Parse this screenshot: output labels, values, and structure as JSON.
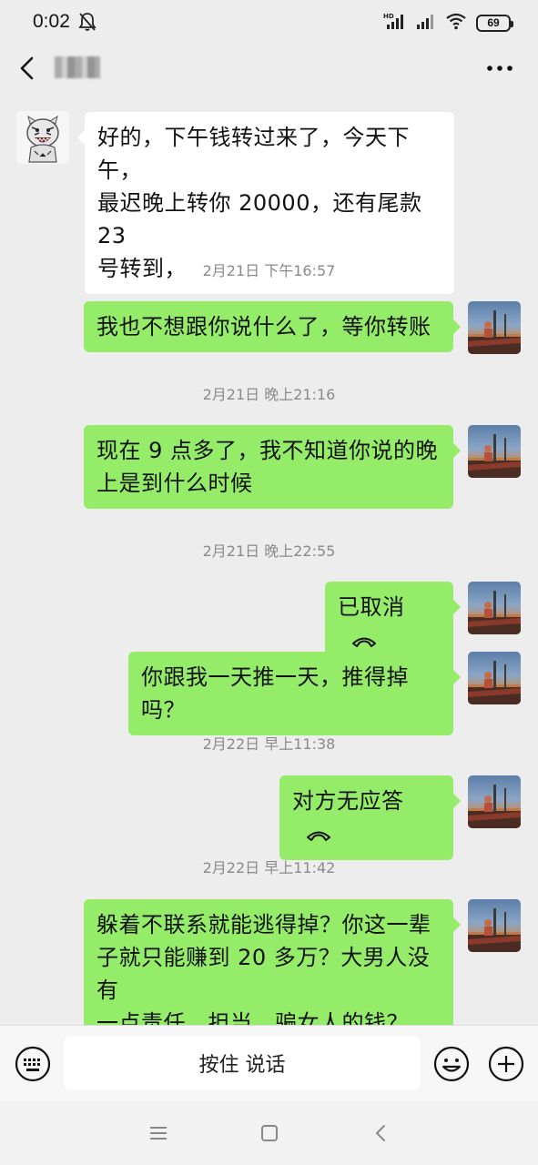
{
  "status_bar": {
    "time": "0:02",
    "battery": "69",
    "icons": [
      "bell-off-icon",
      "hd-signal-icon",
      "signal-icon",
      "wifi-icon",
      "battery-icon"
    ]
  },
  "header": {
    "title": "■■",
    "icons": [
      "back-icon",
      "more-icon"
    ]
  },
  "messages": [
    {
      "side": "left",
      "lines": [
        "好的，下午钱转过来了，今天下午，",
        "最迟晚上转你 20000，还有尾款 23",
        "号转到，"
      ]
    },
    {
      "timestamp": "2月21日 下午16:57"
    },
    {
      "side": "right",
      "lines": [
        "我也不想跟你说什么了，等你转账"
      ]
    },
    {
      "timestamp": "2月21日 晚上21:16"
    },
    {
      "side": "right",
      "lines": [
        "现在 9 点多了，我不知道你说的晚",
        "上是到什么时候"
      ]
    },
    {
      "timestamp": "2月21日 晚上22:55"
    },
    {
      "side": "right",
      "lines": [
        "已取消"
      ],
      "icon": "phone-hangup-icon"
    },
    {
      "side": "right",
      "lines": [
        "你跟我一天推一天，推得掉吗？"
      ]
    },
    {
      "timestamp": "2月22日 早上11:38"
    },
    {
      "side": "right",
      "lines": [
        "对方无应答"
      ],
      "icon": "phone-hangup-icon"
    },
    {
      "timestamp": "2月22日 早上11:42"
    },
    {
      "side": "right",
      "lines": [
        "躲着不联系就能逃得掉？你这一辈",
        "子就只能赚到 20 多万？大男人没有",
        "一点责任，担当，骗女人的钱？"
      ]
    }
  ],
  "input_bar": {
    "hold_to_talk": "按住 说话",
    "icons": [
      "keyboard-icon",
      "emoji-icon",
      "plus-icon"
    ]
  },
  "nav_bar": {
    "icons": [
      "menu-icon",
      "home-icon",
      "back-nav-icon"
    ]
  },
  "colors": {
    "background": "#ededed",
    "bubble_self": "#95ec69",
    "bubble_other": "#ffffff",
    "timestamp": "#8a8a8a"
  }
}
